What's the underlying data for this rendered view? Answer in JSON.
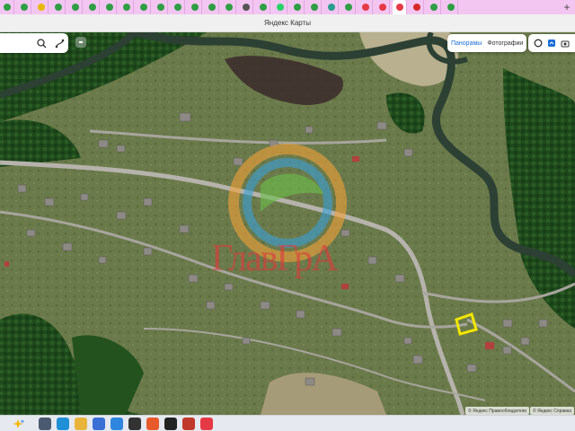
{
  "browser": {
    "tabs": [
      {
        "icon": "green-leaf-icon",
        "color": "#2f9e44"
      },
      {
        "icon": "green-leaf-icon",
        "color": "#2f9e44"
      },
      {
        "icon": "yellow-icon",
        "color": "#e6b800"
      },
      {
        "icon": "green-leaf-icon",
        "color": "#2f9e44"
      },
      {
        "icon": "green-leaf-icon",
        "color": "#2f9e44"
      },
      {
        "icon": "green-leaf-icon",
        "color": "#2f9e44"
      },
      {
        "icon": "green-leaf-icon",
        "color": "#2f9e44"
      },
      {
        "icon": "green-leaf-icon",
        "color": "#2f9e44"
      },
      {
        "icon": "green-leaf-icon",
        "color": "#2f9e44"
      },
      {
        "icon": "green-leaf-icon",
        "color": "#2f9e44"
      },
      {
        "icon": "green-leaf-icon",
        "color": "#2f9e44"
      },
      {
        "icon": "green-leaf-icon",
        "color": "#2f9e44"
      },
      {
        "icon": "green-leaf-icon",
        "color": "#2f9e44"
      },
      {
        "icon": "green-leaf-icon",
        "color": "#2f9e44"
      },
      {
        "icon": "email-icon",
        "color": "#555555"
      },
      {
        "icon": "green-leaf-icon",
        "color": "#2f9e44"
      },
      {
        "icon": "whatsapp-icon",
        "color": "#25d366"
      },
      {
        "icon": "green-leaf-icon",
        "color": "#2f9e44"
      },
      {
        "icon": "green-leaf-icon",
        "color": "#2f9e44"
      },
      {
        "icon": "gear-icon",
        "color": "#2a9d8f"
      },
      {
        "icon": "green-leaf-icon",
        "color": "#2f9e44"
      },
      {
        "icon": "red-circle-icon",
        "color": "#e63946"
      },
      {
        "icon": "red-circle-icon",
        "color": "#e63946"
      },
      {
        "icon": "yandex-maps-icon",
        "color": "#e63946",
        "active": true
      },
      {
        "icon": "red-square-icon",
        "color": "#d62828"
      },
      {
        "icon": "green-leaf-icon",
        "color": "#2f9e44"
      },
      {
        "icon": "green-leaf-icon",
        "color": "#2f9e44"
      }
    ],
    "new_tab": "+",
    "title": "Яндекс Карты"
  },
  "map": {
    "search_icon": "search-icon",
    "route_icon": "route-icon",
    "layers": {
      "panoramas": "Панорамы",
      "photos": "Фотографии"
    },
    "tools": [
      "traffic-icon",
      "layers-icon",
      "camera-icon"
    ],
    "watermark_text": "ГлавГрА",
    "attribution_left": "© Яндекс  Правообладатели",
    "attribution_right": "© Яндекс  Справка"
  },
  "taskbar": {
    "items": [
      {
        "icon": "task-view-icon",
        "color": "#4a5a70"
      },
      {
        "icon": "edge-icon",
        "color": "#1f8fd6"
      },
      {
        "icon": "file-explorer-icon",
        "color": "#e8b43a"
      },
      {
        "icon": "store-icon",
        "color": "#3a6fd6"
      },
      {
        "icon": "app-icon",
        "color": "#2e86de"
      },
      {
        "icon": "media-player-icon",
        "color": "#333333"
      },
      {
        "icon": "app-icon",
        "color": "#e85a2b"
      },
      {
        "icon": "game-icon",
        "color": "#222222"
      },
      {
        "icon": "app-icon",
        "color": "#c0392b"
      },
      {
        "icon": "yandex-browser-icon",
        "color": "#e63946"
      }
    ]
  }
}
